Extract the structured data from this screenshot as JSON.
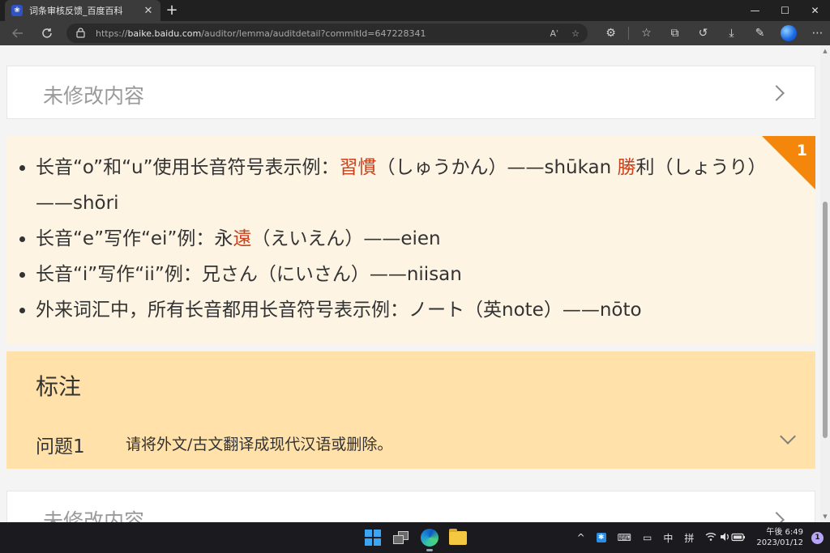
{
  "browser": {
    "tab": {
      "title": "词条审核反馈_百度百科",
      "favicon": "baidu-paw-icon",
      "close": "✕"
    },
    "new_tab": "+",
    "window_controls": {
      "minimize": "—",
      "maximize": "☐",
      "close": "✕"
    },
    "address": {
      "url_prefix": "https://",
      "url_host": "baike.baidu.com",
      "url_path": "/auditor/lemma/auditdetail?commitId=647228341",
      "read_aloud": "Aʾ"
    }
  },
  "page": {
    "collapsed_top": {
      "title": "未修改内容"
    },
    "content": {
      "corner_number": "1",
      "bullets": [
        {
          "segments": [
            {
              "text": "长音“o”和“u”使用长音符号表示例：",
              "hl": false
            },
            {
              "text": "習慣",
              "hl": true
            },
            {
              "text": "（しゅうかん）——shūkan ",
              "hl": false
            },
            {
              "text": "勝",
              "hl": true
            },
            {
              "text": "利（しょうり）——shōri",
              "hl": false
            }
          ]
        },
        {
          "segments": [
            {
              "text": "长音“e”写作“ei”例：永",
              "hl": false
            },
            {
              "text": "遠",
              "hl": true
            },
            {
              "text": "（えいえん）——eien",
              "hl": false
            }
          ]
        },
        {
          "segments": [
            {
              "text": "长音“i”写作“ii”例：兄さん（にいさん）——niisan",
              "hl": false
            }
          ]
        },
        {
          "segments": [
            {
              "text": "外来词汇中，所有长音都用长音符号表示例：ノート（英note）——nōto",
              "hl": false
            }
          ]
        }
      ]
    },
    "annotation": {
      "title": "标注",
      "issue_label": "问题1",
      "issue_text": "请将外文/古文翻译成现代汉语或删除。"
    },
    "collapsed_bottom": {
      "title": "未修改内容"
    }
  },
  "taskbar": {
    "tray": {
      "chevron": "^",
      "ime_mode": "中",
      "ime_type": "拼",
      "time": "午後 6:49",
      "date": "2023/01/12",
      "notifications": "1"
    }
  },
  "colors": {
    "highlight": "#c8401c",
    "corner_badge": "#f3860b",
    "content_bg": "#fdf4e3",
    "annotation_bg": "#ffe1a9"
  }
}
